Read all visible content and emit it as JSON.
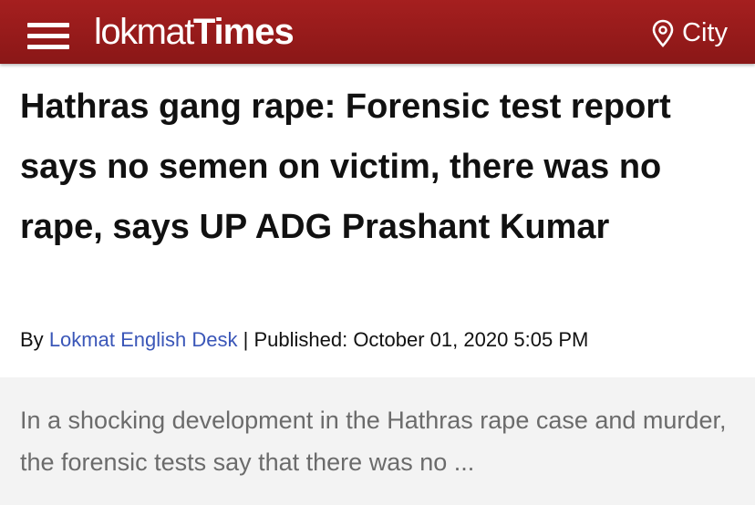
{
  "header": {
    "logo_part1": "lokmat",
    "logo_part2": "Times",
    "city_label": "City"
  },
  "article": {
    "headline": "Hathras gang rape: Forensic test report says no semen on victim, there was no rape, says UP ADG Prashant Kumar",
    "by_prefix": "By",
    "author": "Lokmat English Desk",
    "separator": "|",
    "published_label": "Published:",
    "published_date": "October 01, 2020 5:05 PM",
    "summary": "In a shocking development in the Hathras rape case and murder, the forensic tests say that there was no ..."
  },
  "colors": {
    "header_bg": "#9c1c1c",
    "author_link": "#3a56b8",
    "summary_bg": "#f3f3f3"
  },
  "icons": {
    "menu": "hamburger-menu-icon",
    "city": "location-pin-icon"
  }
}
